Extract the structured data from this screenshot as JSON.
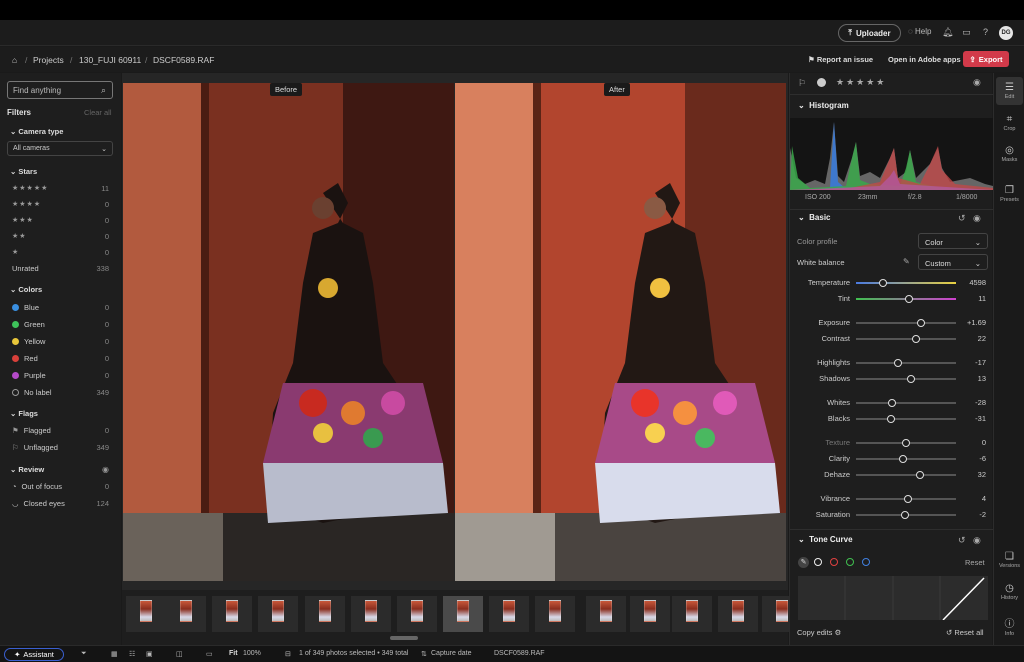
{
  "appbar": {
    "uploader": "Uploader",
    "help": "Help",
    "avatar": "DG"
  },
  "breadcrumb": {
    "items": [
      "Projects",
      "130_FUJI 60911",
      "DSCF0589.RAF"
    ]
  },
  "actions": {
    "report": "Report an issue",
    "open": "Open in Adobe apps",
    "export": "Export"
  },
  "left": {
    "search_placeholder": "Find anything",
    "filters": "Filters",
    "clear_all": "Clear all",
    "camera_type": "Camera type",
    "all_cameras": "All cameras",
    "stars_title": "Stars",
    "stars": [
      {
        "label": "★★★★★",
        "count": "11"
      },
      {
        "label": "★★★★",
        "count": "0"
      },
      {
        "label": "★★★",
        "count": "0"
      },
      {
        "label": "★★",
        "count": "0"
      },
      {
        "label": "★",
        "count": "0"
      },
      {
        "label": "Unrated",
        "count": "338"
      }
    ],
    "colors_title": "Colors",
    "colors": [
      {
        "label": "Blue",
        "count": "0",
        "color": "#3a8fe0"
      },
      {
        "label": "Green",
        "count": "0",
        "color": "#3ec25a"
      },
      {
        "label": "Yellow",
        "count": "0",
        "color": "#e8c63a"
      },
      {
        "label": "Red",
        "count": "0",
        "color": "#d8403a"
      },
      {
        "label": "Purple",
        "count": "0",
        "color": "#b44ac8"
      },
      {
        "label": "No label",
        "count": "349",
        "color": "none"
      }
    ],
    "flags_title": "Flags",
    "flags": [
      {
        "label": "Flagged",
        "count": "0"
      },
      {
        "label": "Unflagged",
        "count": "349"
      }
    ],
    "review_title": "Review",
    "review": [
      {
        "label": "Out of focus",
        "count": "0"
      },
      {
        "label": "Closed eyes",
        "count": "124"
      }
    ]
  },
  "viewer": {
    "before": "Before",
    "after": "After"
  },
  "right": {
    "histogram_title": "Histogram",
    "exif": [
      "ISO 200",
      "23mm",
      "f/2.8",
      "1/8000"
    ],
    "basic_title": "Basic",
    "color_profile_label": "Color profile",
    "color_profile": "Color",
    "wb_label": "White balance",
    "wb": "Custom",
    "sliders": [
      {
        "label": "Temperature",
        "value": "4598",
        "pos": 0.27,
        "type": "temp"
      },
      {
        "label": "Tint",
        "value": "11",
        "pos": 0.53,
        "type": "tint"
      },
      {
        "label": "Exposure",
        "value": "+1.69",
        "pos": 0.65,
        "type": "n"
      },
      {
        "label": "Contrast",
        "value": "22",
        "pos": 0.6,
        "type": "n"
      },
      {
        "label": "Highlights",
        "value": "-17",
        "pos": 0.42,
        "type": "n"
      },
      {
        "label": "Shadows",
        "value": "13",
        "pos": 0.55,
        "type": "n"
      },
      {
        "label": "Whites",
        "value": "-28",
        "pos": 0.36,
        "type": "n"
      },
      {
        "label": "Blacks",
        "value": "-31",
        "pos": 0.35,
        "type": "n"
      },
      {
        "label": "Texture",
        "value": "0",
        "pos": 0.5,
        "type": "n"
      },
      {
        "label": "Clarity",
        "value": "-6",
        "pos": 0.47,
        "type": "n"
      },
      {
        "label": "Dehaze",
        "value": "32",
        "pos": 0.64,
        "type": "n"
      },
      {
        "label": "Vibrance",
        "value": "4",
        "pos": 0.52,
        "type": "n"
      },
      {
        "label": "Saturation",
        "value": "-2",
        "pos": 0.49,
        "type": "n"
      }
    ],
    "tone_curve_title": "Tone Curve",
    "reset": "Reset",
    "copy_edits": "Copy edits",
    "reset_all": "Reset all"
  },
  "rail": [
    "Edit",
    "Crop",
    "Masks",
    "Presets",
    "Versions",
    "History",
    "Info"
  ],
  "bottom": {
    "assistant": "Assistant",
    "fit": "Fit",
    "zoom": "100%",
    "selection": "1 of 349 photos selected • 349 total",
    "sort": "Capture date",
    "filename": "DSCF0589.RAF"
  }
}
